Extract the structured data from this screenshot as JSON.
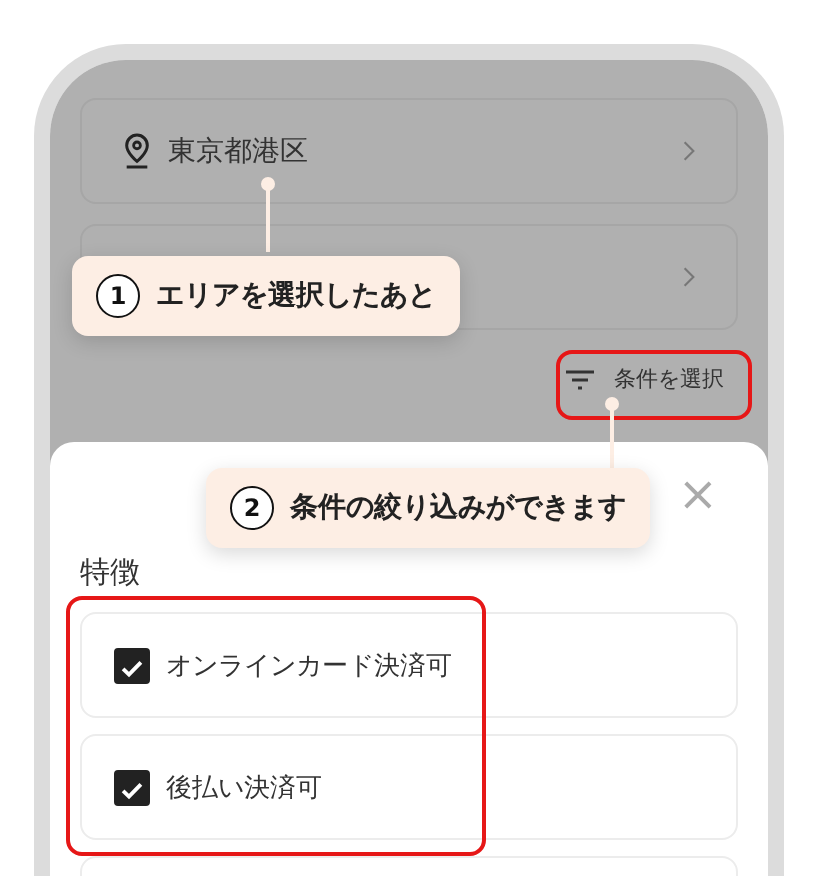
{
  "area_rows": [
    {
      "kind": "location",
      "label": "東京都港区"
    },
    {
      "kind": "plain"
    }
  ],
  "filter_button": {
    "label": "条件を選択"
  },
  "sheet": {
    "close": "×",
    "heading": "特徴",
    "options": [
      {
        "kind": "checkbox",
        "label": "オンラインカード決済可",
        "checked": true
      },
      {
        "kind": "checkbox",
        "label": "後払い決済可",
        "checked": true
      },
      {
        "kind": "blank"
      }
    ]
  },
  "callouts": [
    {
      "number": "1",
      "text": "エリアを選択したあと"
    },
    {
      "number": "2",
      "text": "条件の絞り込みができます"
    }
  ]
}
